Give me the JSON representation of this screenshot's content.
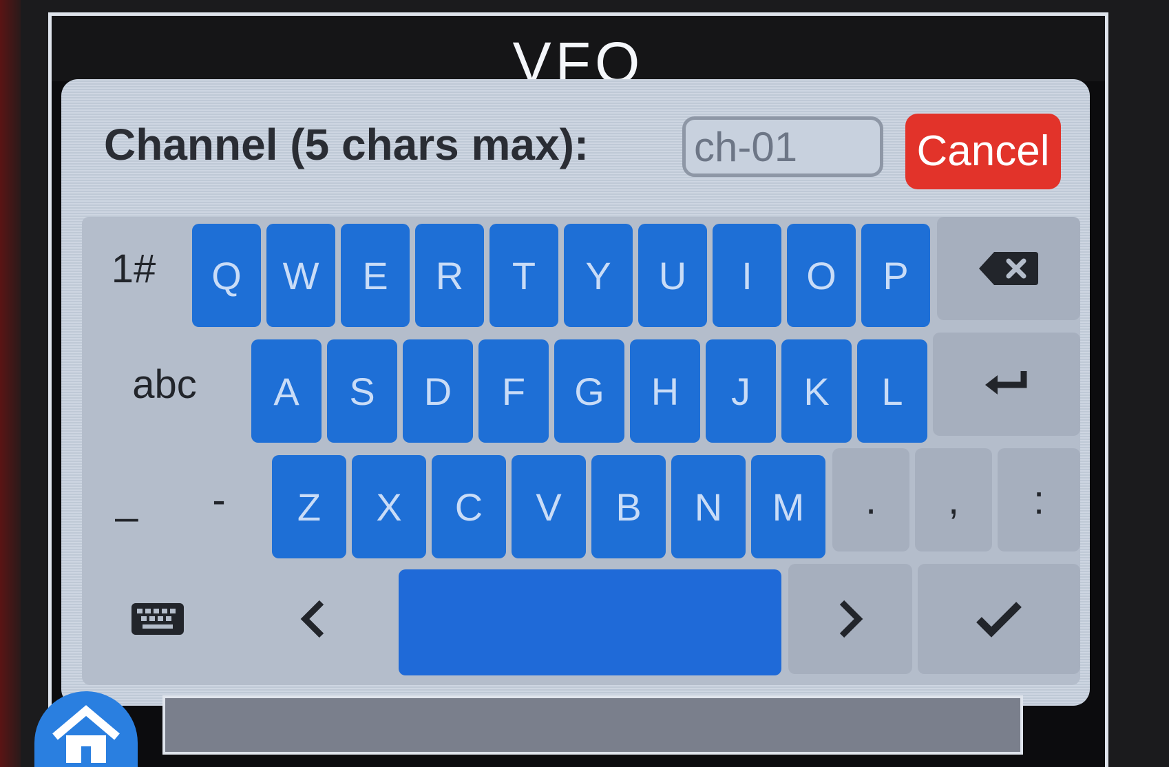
{
  "app": {
    "title": "VFO"
  },
  "dialog": {
    "label": "Channel (5 chars max):",
    "input_value": "ch-01",
    "cancel_label": "Cancel"
  },
  "keyboard": {
    "mode_symbols": "1#",
    "mode_letters": "abc",
    "row1": [
      "Q",
      "W",
      "E",
      "R",
      "T",
      "Y",
      "U",
      "I",
      "O",
      "P"
    ],
    "row2": [
      "A",
      "S",
      "D",
      "F",
      "G",
      "H",
      "J",
      "K",
      "L"
    ],
    "row3": [
      "Z",
      "X",
      "C",
      "V",
      "B",
      "N",
      "M"
    ],
    "row3_left": [
      "_",
      "-"
    ],
    "row3_right": [
      ".",
      ",",
      ":"
    ],
    "backspace_icon": "backspace-icon",
    "enter_icon": "enter-icon",
    "keyboard_icon": "keyboard-icon",
    "left_arrow": "<",
    "right_arrow": ">",
    "ok_icon": "checkmark-icon"
  },
  "colors": {
    "accent": "#1e6fd6",
    "cancel": "#e2332a",
    "panel": "#c5cfdd"
  }
}
